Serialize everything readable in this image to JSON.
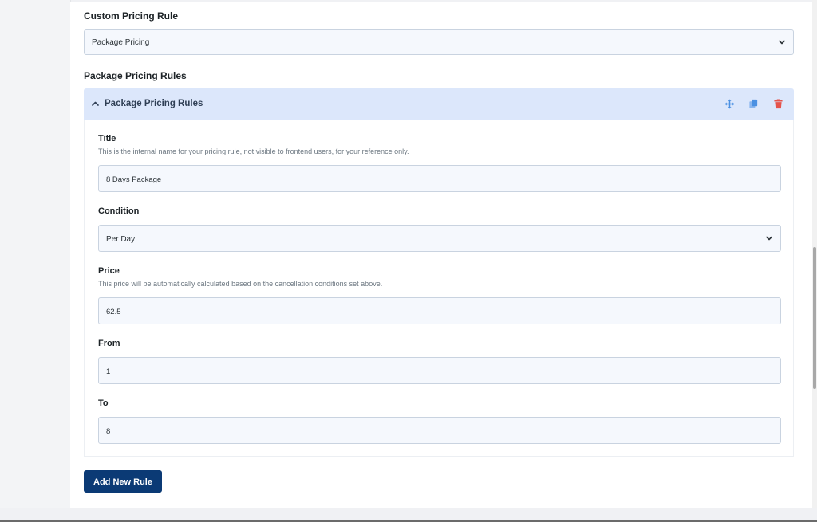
{
  "custom_pricing": {
    "heading": "Custom Pricing Rule",
    "selected": "Package Pricing"
  },
  "package_rules": {
    "heading": "Package Pricing Rules",
    "accordion": {
      "title": "Package Pricing Rules",
      "expanded": true,
      "icons": [
        "move-icon",
        "duplicate-icon",
        "trash-icon"
      ],
      "icon_colors": {
        "move": "#4a90e2",
        "duplicate": "#4a90e2",
        "trash": "#e5534b"
      }
    },
    "fields": {
      "title": {
        "label": "Title",
        "help": "This is the internal name for your pricing rule, not visible to frontend users, for your reference only.",
        "value": "8 Days Package"
      },
      "condition": {
        "label": "Condition",
        "value": "Per Day"
      },
      "price": {
        "label": "Price",
        "help": "This price will be automatically calculated based on the cancellation conditions set above.",
        "value": "62.5"
      },
      "from": {
        "label": "From",
        "value": "1"
      },
      "to": {
        "label": "To",
        "value": "8"
      }
    }
  },
  "actions": {
    "add_rule_label": "Add New Rule"
  },
  "colors": {
    "accent": "#0b3a75",
    "accordion_header_bg": "#dce7fb",
    "input_bg": "#f5f8fd"
  }
}
